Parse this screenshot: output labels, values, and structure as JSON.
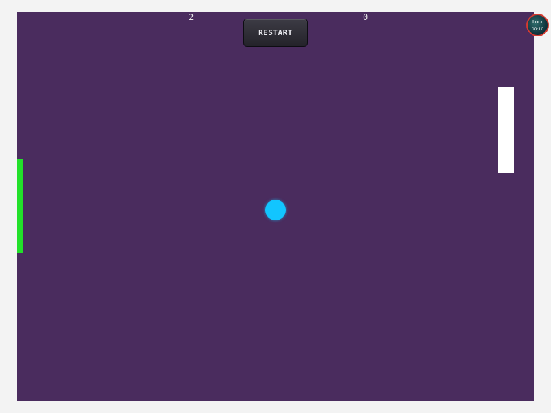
{
  "game": {
    "score_left": "2",
    "score_right": "0",
    "restart_label": "RESTART"
  },
  "recorder": {
    "name": "Lorx",
    "time": "00:10"
  },
  "colors": {
    "arena": "#4a2c5e",
    "left_paddle": "#22e02a",
    "right_paddle": "#ffffff",
    "ball": "#12c5ff",
    "frame": "#f3f3f3"
  }
}
